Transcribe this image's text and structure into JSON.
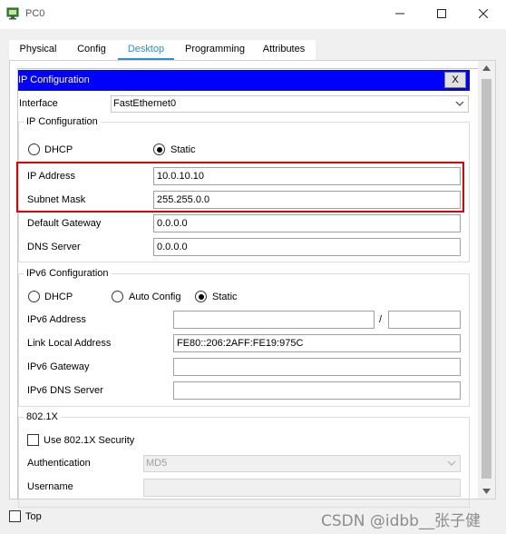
{
  "window": {
    "title": "PC0",
    "icon": "packet-tracer-pc-icon",
    "controls": [
      "minimize-icon",
      "maximize-icon",
      "close-icon"
    ]
  },
  "tabs": [
    {
      "label": "Physical"
    },
    {
      "label": "Config"
    },
    {
      "label": "Desktop",
      "active": true
    },
    {
      "label": "Programming"
    },
    {
      "label": "Attributes"
    }
  ],
  "ip_config": {
    "title": "IP Configuration",
    "close_label": "X",
    "interface_label": "Interface",
    "interface_value": "FastEthernet0",
    "ipv4": {
      "legend": "IP Configuration",
      "dhcp_label": "DHCP",
      "static_label": "Static",
      "selected": "Static",
      "ip_address_label": "IP Address",
      "ip_address": "10.0.10.10",
      "subnet_mask_label": "Subnet Mask",
      "subnet_mask": "255.255.0.0",
      "gateway_label": "Default Gateway",
      "gateway": "0.0.0.0",
      "dns_label": "DNS Server",
      "dns": "0.0.0.0"
    },
    "ipv6": {
      "legend": "IPv6 Configuration",
      "dhcp_label": "DHCP",
      "auto_label": "Auto Config",
      "static_label": "Static",
      "selected": "Static",
      "address_label": "IPv6 Address",
      "address": "",
      "slash": "/",
      "prefix": "",
      "link_local_label": "Link Local Address",
      "link_local": "FE80::206:2AFF:FE19:975C",
      "gateway_label": "IPv6 Gateway",
      "gateway": "",
      "dns_label": "IPv6 DNS Server",
      "dns": ""
    },
    "dot1x": {
      "legend": "802.1X",
      "use_label": "Use 802.1X Security",
      "use_checked": false,
      "auth_label": "Authentication",
      "auth_value": "MD5",
      "username_label": "Username",
      "username": ""
    }
  },
  "footer": {
    "top_label": "Top",
    "top_checked": false
  },
  "watermark": "CSDN @idbb__张子健",
  "colors": {
    "ip_bar": "#0000ff",
    "active_tab": "#2a8fd6",
    "highlight_box": "#e00000"
  }
}
